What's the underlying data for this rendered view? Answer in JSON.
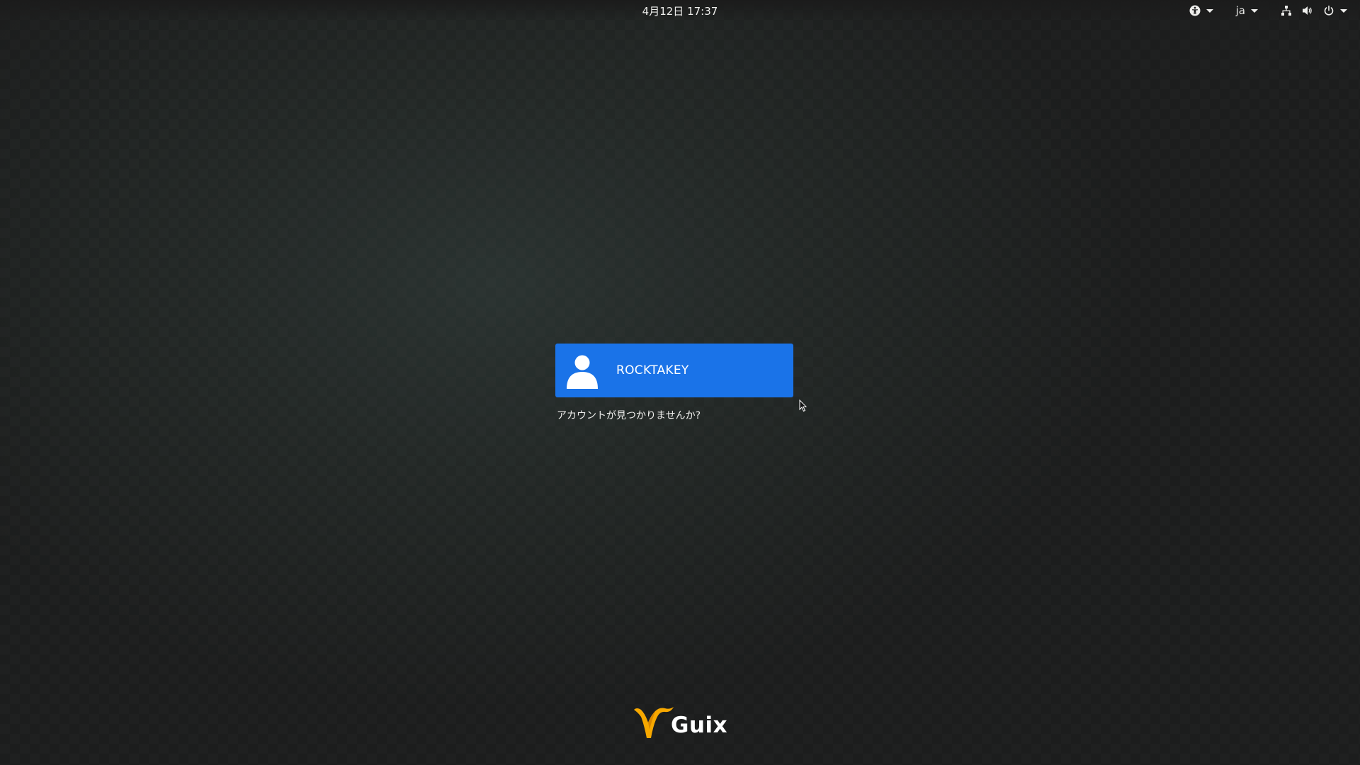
{
  "top_bar": {
    "clock": "4月12日  17:37",
    "language": "ja",
    "icons": [
      "accessibility-icon",
      "network-icon",
      "volume-icon",
      "power-icon"
    ]
  },
  "users": [
    {
      "name": "ROCKTAKEY"
    }
  ],
  "not_listed_label": "アカウントが見つかりませんか?",
  "logo": {
    "text": "Guix"
  },
  "colors": {
    "accent": "#1a73e8",
    "logo_orange": "#f7a800",
    "background": "#232826"
  }
}
